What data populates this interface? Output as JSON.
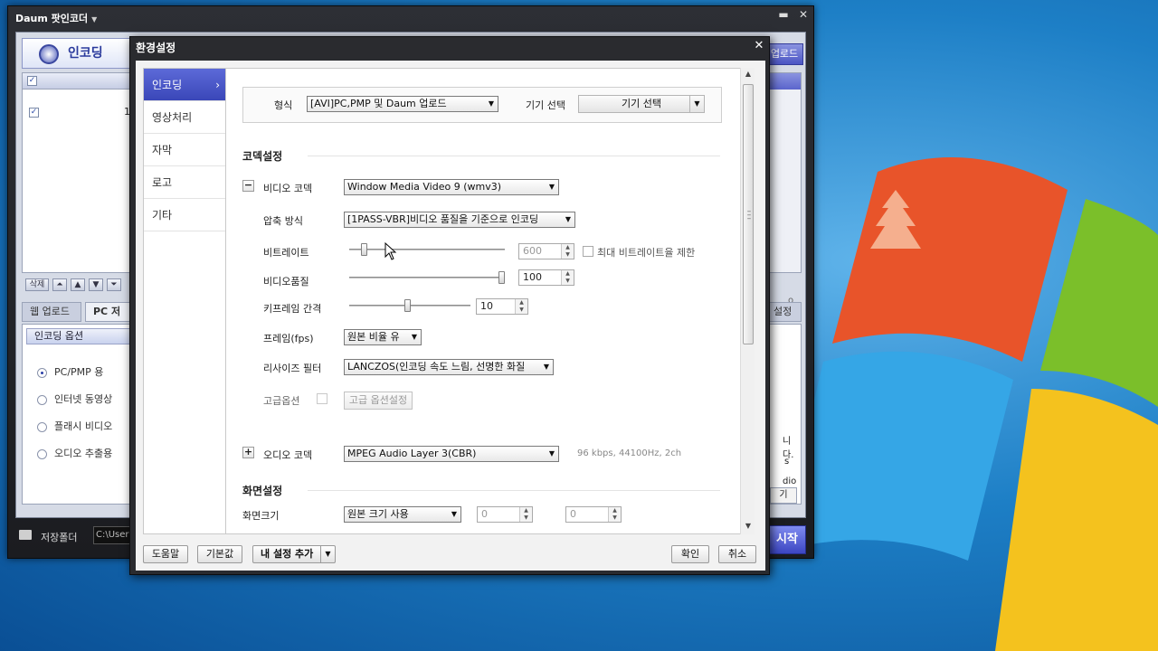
{
  "back_window": {
    "title": "Daum 팟인코더",
    "encode_tab": "인코딩",
    "upload_tab": "업로드",
    "list_row_number": "1",
    "delete_btn": "삭제",
    "bottom_tabs": [
      "웹 업로드용",
      "PC 저장용"
    ],
    "right_settings_btn": "설정",
    "options_title": "인코딩 옵션",
    "options": [
      {
        "label": "PC/PMP 용",
        "selected": true
      },
      {
        "label": "인터넷 동영상",
        "selected": false
      },
      {
        "label": "플래시 비디오",
        "selected": false
      },
      {
        "label": "오디오 추출용",
        "selected": false
      }
    ],
    "right_fragments": [
      "니다.",
      "s",
      "dio",
      "기"
    ],
    "save_folder_label": "저장폴더",
    "save_path": "C:\\Users",
    "start_btn": "시작"
  },
  "dialog": {
    "title": "환경설정",
    "nav": [
      {
        "label": "인코딩",
        "active": true
      },
      {
        "label": "영상처리",
        "active": false
      },
      {
        "label": "자막",
        "active": false
      },
      {
        "label": "로고",
        "active": false
      },
      {
        "label": "기타",
        "active": false
      }
    ],
    "format_label": "형식",
    "format_value": "[AVI]PC,PMP 및 Daum 업로드",
    "device_label": "기기 선택",
    "device_value": "기기 선택",
    "codec_section": "코덱설정",
    "video_codec_label": "비디오 코덱",
    "video_codec_value": "Window Media Video 9 (wmv3)",
    "compression_label": "압축 방식",
    "compression_value": "[1PASS-VBR]비디오 품질을 기준으로 인코딩",
    "bitrate_label": "비트레이트",
    "bitrate_value": "600",
    "bitrate_level": 0.08,
    "max_bitrate_label": "최대 비트레이트율 제한",
    "quality_label": "비디오품질",
    "quality_value": "100",
    "quality_level": 1.0,
    "keyframe_label": "키프레임 간격",
    "keyframe_value": "10",
    "keyframe_level": 0.48,
    "fps_label": "프레임(fps)",
    "fps_value": "원본 비율 유",
    "resize_label": "리사이즈 필터",
    "resize_value": "LANCZOS(인코딩 속도 느림, 선명한 화질",
    "advanced_label": "고급옵션",
    "advanced_btn": "고급 옵션설정",
    "audio_codec_label": "오디오 코덱",
    "audio_codec_value": "MPEG Audio Layer 3(CBR)",
    "audio_info": "96 kbps, 44100Hz, 2ch",
    "screen_section": "화면설정",
    "screen_size_label": "화면크기",
    "screen_size_value": "원본 크기 사용",
    "width_value": "0",
    "height_value": "0",
    "footer": {
      "help": "도움말",
      "default": "기본값",
      "add_my_settings": "내 설정 추가",
      "ok": "확인",
      "cancel": "취소"
    }
  },
  "colors": {
    "accent": "#3a47b8",
    "desktop": "#1d7fc6"
  }
}
